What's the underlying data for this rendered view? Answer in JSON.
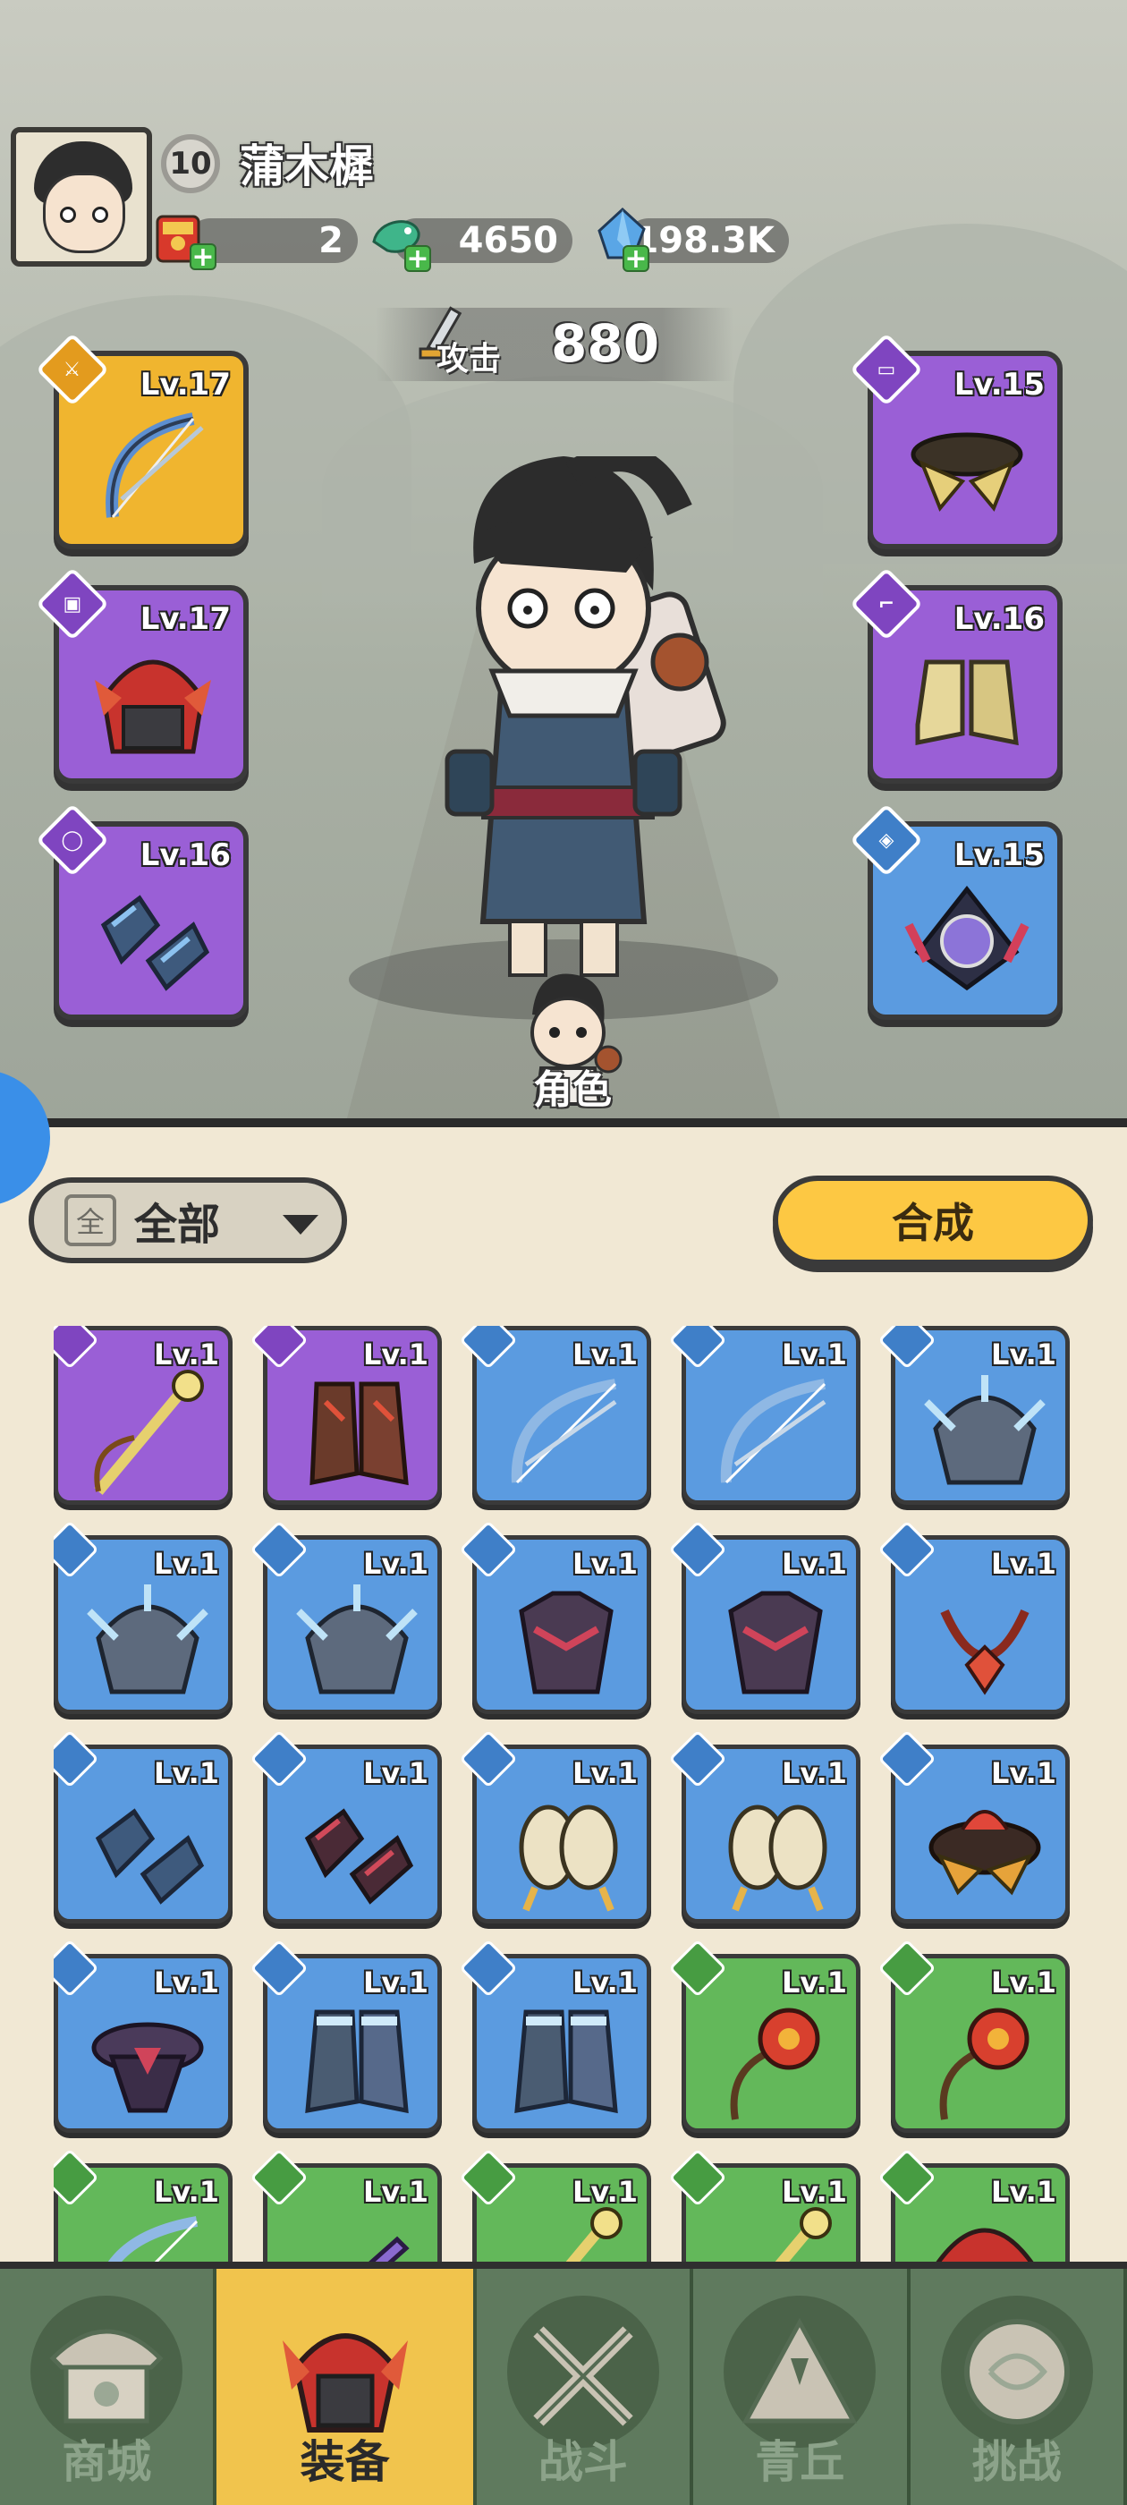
{
  "player": {
    "level": "10",
    "name": "蒲木樨"
  },
  "resources": [
    {
      "name": "red-envelope",
      "value": "2"
    },
    {
      "name": "jade-coin",
      "value": "4650"
    },
    {
      "name": "crystal",
      "value": "198.3K"
    }
  ],
  "attack": {
    "label": "攻击",
    "value": "880"
  },
  "equipped": {
    "left": [
      {
        "level": "Lv.17",
        "rarity": "gold",
        "item": "bow"
      },
      {
        "level": "Lv.17",
        "rarity": "purple",
        "item": "helmet"
      },
      {
        "level": "Lv.16",
        "rarity": "purple",
        "item": "bracers"
      }
    ],
    "right": [
      {
        "level": "Lv.15",
        "rarity": "purple",
        "item": "belt"
      },
      {
        "level": "Lv.16",
        "rarity": "purple",
        "item": "boots"
      },
      {
        "level": "Lv.15",
        "rarity": "blue",
        "item": "amulet"
      }
    ]
  },
  "role_label": "角色",
  "filter": {
    "box": "全",
    "label": "全部"
  },
  "compose_label": "合成",
  "inventory": [
    [
      {
        "level": "Lv.1",
        "rarity": "purple",
        "item": "staff"
      },
      {
        "level": "Lv.1",
        "rarity": "purple",
        "item": "boots"
      },
      {
        "level": "Lv.1",
        "rarity": "blue",
        "item": "bow"
      },
      {
        "level": "Lv.1",
        "rarity": "blue",
        "item": "bow"
      },
      {
        "level": "Lv.1",
        "rarity": "blue",
        "item": "helmet"
      }
    ],
    [
      {
        "level": "Lv.1",
        "rarity": "blue",
        "item": "helmet"
      },
      {
        "level": "Lv.1",
        "rarity": "blue",
        "item": "helmet"
      },
      {
        "level": "Lv.1",
        "rarity": "blue",
        "item": "armor"
      },
      {
        "level": "Lv.1",
        "rarity": "blue",
        "item": "armor"
      },
      {
        "level": "Lv.1",
        "rarity": "blue",
        "item": "necklace"
      }
    ],
    [
      {
        "level": "Lv.1",
        "rarity": "blue",
        "item": "bracers"
      },
      {
        "level": "Lv.1",
        "rarity": "blue",
        "item": "bracers"
      },
      {
        "level": "Lv.1",
        "rarity": "blue",
        "item": "gloves"
      },
      {
        "level": "Lv.1",
        "rarity": "blue",
        "item": "gloves"
      },
      {
        "level": "Lv.1",
        "rarity": "blue",
        "item": "belt"
      }
    ],
    [
      {
        "level": "Lv.1",
        "rarity": "blue",
        "item": "belt"
      },
      {
        "level": "Lv.1",
        "rarity": "blue",
        "item": "boots"
      },
      {
        "level": "Lv.1",
        "rarity": "blue",
        "item": "boots"
      },
      {
        "level": "Lv.1",
        "rarity": "green",
        "item": "flower-whip"
      },
      {
        "level": "Lv.1",
        "rarity": "green",
        "item": "flower-whip"
      }
    ],
    [
      {
        "level": "Lv.1",
        "rarity": "green",
        "item": "bow"
      },
      {
        "level": "Lv.1",
        "rarity": "green",
        "item": "sword"
      },
      {
        "level": "Lv.1",
        "rarity": "green",
        "item": "staff"
      },
      {
        "level": "Lv.1",
        "rarity": "green",
        "item": "staff"
      },
      {
        "level": "Lv.1",
        "rarity": "green",
        "item": "helmet"
      }
    ]
  ],
  "nav": [
    {
      "label": "商城",
      "icon": "shop-icon"
    },
    {
      "label": "装备",
      "icon": "equipment-icon",
      "active": true
    },
    {
      "label": "战斗",
      "icon": "crossed-swords-icon"
    },
    {
      "label": "青丘",
      "icon": "mountain-icon"
    },
    {
      "label": "挑战",
      "icon": "challenge-orb-icon"
    }
  ],
  "colors": {
    "gold": "#f0b52f",
    "purple": "#9a5fd6",
    "blue": "#5b9be0",
    "green": "#63b85a",
    "nav_active": "#f1c44d",
    "nav_bg": "#5f7a5e",
    "compose": "#fdc843"
  }
}
